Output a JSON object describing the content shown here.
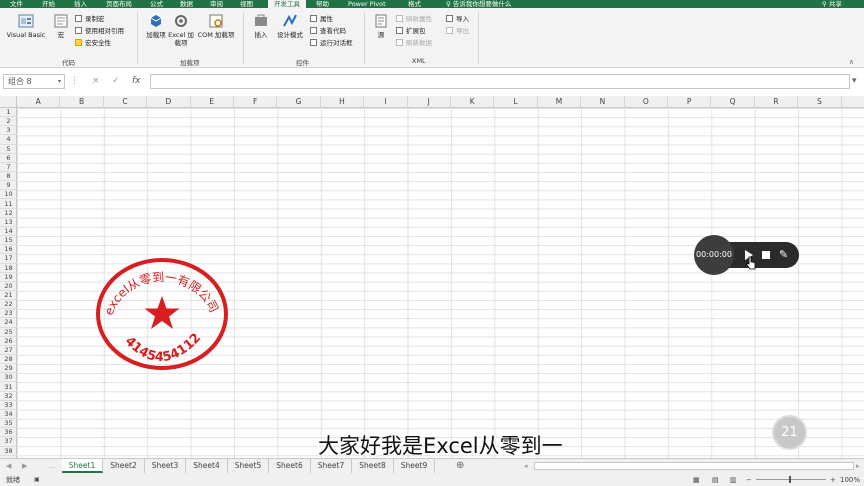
{
  "ribbon_tabs": [
    "文件",
    "开始",
    "插入",
    "页面布局",
    "公式",
    "数据",
    "审阅",
    "视图",
    "开发工具",
    "帮助",
    "Power Pivot",
    "格式",
    "告诉我你想要做什么",
    "共享"
  ],
  "active_tab": "开发工具",
  "code_group": {
    "label": "代码",
    "visual_basic": "Visual Basic",
    "macros": "宏",
    "record_macro": "录制宏",
    "relative_refs": "使用相对引用",
    "macro_security": "宏安全性"
  },
  "addins_group": {
    "label": "加载项",
    "addins": "加载项",
    "excel_addins": "Excel 加载项",
    "com_addins": "COM 加载项"
  },
  "controls_group": {
    "label": "控件",
    "insert": "插入",
    "design_mode": "设计模式",
    "properties": "属性",
    "view_code": "查看代码",
    "run_dialog": "运行对话框"
  },
  "xml_group": {
    "label": "XML",
    "source": "源",
    "map_props": "映射属性",
    "expansion_packs": "扩展包",
    "refresh_data": "刷新数据",
    "import": "导入",
    "export": "导出"
  },
  "formula_bar": {
    "name_box": "组合 8",
    "cancel": "×",
    "enter": "✓",
    "fx": "fx",
    "value": ""
  },
  "columns": [
    "A",
    "B",
    "C",
    "D",
    "E",
    "F",
    "G",
    "H",
    "I",
    "J",
    "K",
    "L",
    "M",
    "N",
    "O",
    "P",
    "Q",
    "R",
    "S"
  ],
  "rows": [
    "1",
    "2",
    "3",
    "4",
    "5",
    "6",
    "7",
    "8",
    "9",
    "10",
    "11",
    "12",
    "13",
    "14",
    "15",
    "16",
    "17",
    "18",
    "19",
    "20",
    "21",
    "22",
    "23",
    "24",
    "25",
    "26",
    "27",
    "28",
    "29",
    "30",
    "31",
    "32",
    "33",
    "34",
    "35",
    "36",
    "37",
    "38"
  ],
  "stamp": {
    "arc_text": "excel从零到一有限公司",
    "bottom_text": "4145454112",
    "color": "#d81e1e"
  },
  "sheets": [
    "Sheet1",
    "Sheet2",
    "Sheet3",
    "Sheet4",
    "Sheet5",
    "Sheet6",
    "Sheet7",
    "Sheet8",
    "Sheet9"
  ],
  "active_sheet": "Sheet1",
  "status": {
    "ready": "就绪",
    "zoom": "100%"
  },
  "recorder": {
    "time": "00:00:00"
  },
  "subtitle": "大家好我是Excel从零到一",
  "badge": "21"
}
